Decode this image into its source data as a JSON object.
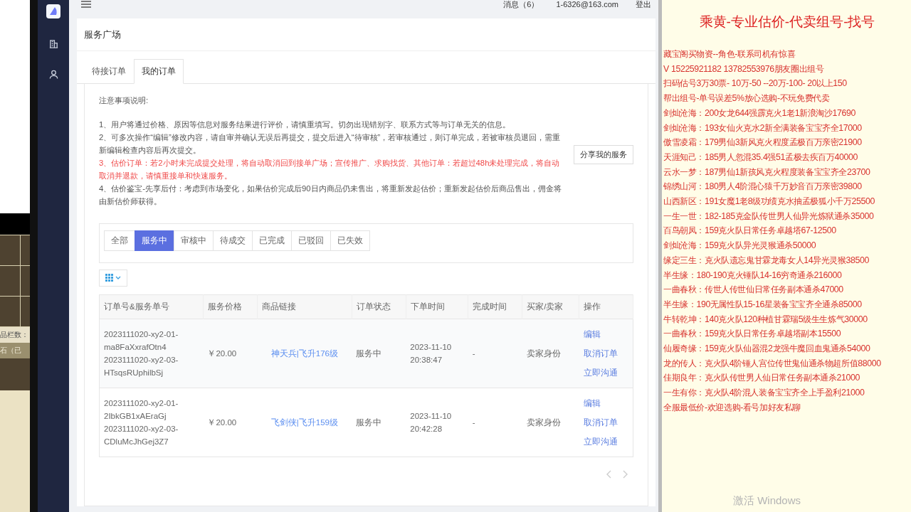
{
  "background_app": {
    "texts": [
      "品栏数：",
      "石（已"
    ]
  },
  "header": {
    "messages": "消息（6）",
    "email": "1-6326@163.com",
    "logout": "登出"
  },
  "page_title": "服务广场",
  "tabs": [
    {
      "label": "待接订单",
      "selected": false
    },
    {
      "label": "我的订单",
      "selected": true
    }
  ],
  "notice": {
    "title": "注意事项说明:",
    "items": [
      {
        "kind": "normal",
        "text": "1、用户将通过价格、原因等信息对服务结果进行评价，请慎重填写。切勿出现错别字、联系方式等与订单无关的信息。"
      },
      {
        "kind": "normal",
        "text": "2、可多次操作“编辑”修改内容，请自审并确认无误后再提交，提交后进入“待审核”，若审核通过，则订单完成，若被审核员退回，需重新编辑检查内容后再次提交。"
      },
      {
        "kind": "warning",
        "text": "3、估价订单：若2小时未完成提交处理，将自动取消回到接单广场；宣传推广、求购找货、其他订单：若超过48h未处理完成，将自动取消并退款，请慎重接单和快速服务。"
      },
      {
        "kind": "normal",
        "text": "4、估价鉴宝-先享后付：考虑到市场变化，如果估价完成后90日内商品仍未售出，将重新发起估价；重新发起估价后商品售出，佣金将由新估价师获得。"
      }
    ]
  },
  "share_button": "分享我的服务",
  "filters": [
    {
      "label": "全部",
      "selected": false
    },
    {
      "label": "服务中",
      "selected": true
    },
    {
      "label": "审核中",
      "selected": false
    },
    {
      "label": "待成交",
      "selected": false
    },
    {
      "label": "已完成",
      "selected": false
    },
    {
      "label": "已驳回",
      "selected": false
    },
    {
      "label": "已失效",
      "selected": false
    }
  ],
  "table": {
    "columns": [
      "订单号&服务单号",
      "服务价格",
      "商品链接",
      "订单状态",
      "下单时间",
      "完成时间",
      "买家/卖家",
      "操作"
    ],
    "rows": [
      {
        "id_lines": [
          "2023111020-xy2-01-",
          "ma8FaXxrafOtn4",
          "2023111020-xy2-03-",
          "HTsqsRUphilbSj"
        ],
        "price": "￥20.00",
        "product": "神天兵|飞升176级",
        "status": "服务中",
        "ordered_at": [
          "2023-11-10",
          "20:38:47"
        ],
        "completed": "-",
        "role": "卖家身份",
        "actions": [
          "编辑",
          "取消订单",
          "立即沟通"
        ]
      },
      {
        "id_lines": [
          "2023111020-xy2-01-",
          "2IbkGB1xAEraGj",
          "2023111020-xy2-03-",
          "CDluMcJhGej3Z7"
        ],
        "price": "￥20.00",
        "product": "飞剑侠|飞升159级",
        "status": "服务中",
        "ordered_at": [
          "2023-11-10",
          "20:42:28"
        ],
        "completed": "-",
        "role": "卖家身份",
        "actions": [
          "编辑",
          "取消订单",
          "立即沟通"
        ]
      }
    ]
  },
  "side_panel": {
    "title": "乘黄-专业估价-代卖组号-找号",
    "lines": [
      "藏宝阁买物资--角色-联系司机有惊喜",
      "V 15225921182  13782553976朋友圈出组号",
      "扫码估号3万30票- 10万-50 --20万-100- 20以上150",
      "帮出组号-单号误差5%放心选购-不玩免费代卖",
      "剑灿沧海：200女龙644强霹克火1老1新浪淘沙17690",
      "剑灿沧海：193女仙火克水2新全满装备宝宝齐全17000",
      "傲雪凌霜：179男仙3新风克火程度孟极百万亲密21900",
      "天涯知己：185男人忽混35.4强51孟极去疾百万40000",
      "云水一梦：187男仙1新孩风克火程度装备宝宝齐全23700",
      "锦绣山河：180男人4阶混心猿千万妙音百万亲密39800",
      "山西新区：191女魔1老8级功绩克水抽孟极狐小千万25500",
      "一生一世：182-185克金队传世男人仙异光炼狱通杀35000",
      "百鸟朝凤：159克火队日常任务卓越塔67-12500",
      "剑灿沧海：159克火队异光灵猴通杀50000",
      "缘定三生：克火队遗忘鬼甘霖龙毒女人14异光灵猴38500",
      "半生缘：180-190克火锤队14-16穷奇通杀216000",
      "一曲春秋：传世人传世仙日常任务副本通杀47000",
      "半生缘：190无属性队15-16星装备宝宝齐全通杀85000",
      "牛转乾坤：140克火队120种植甘霖瑞5级生生炼气30000",
      "一曲春秋：159克火队日常任务卓越塔副本15500",
      "仙履奇缘：159克火队仙器混2龙强牛魔回血鬼通杀54000",
      "龙的传人：克火队4阶锤人宫位传世鬼仙通杀物超所值88000",
      "佳期良年：克火队传世男人仙日常任务副本通杀21000",
      "一生有你：克火队4阶混人装备宝宝齐全上手盈利21000",
      "全服最低价-欢迎选购-看号加好友私聊"
    ]
  },
  "os_notice": "激活 Windows"
}
